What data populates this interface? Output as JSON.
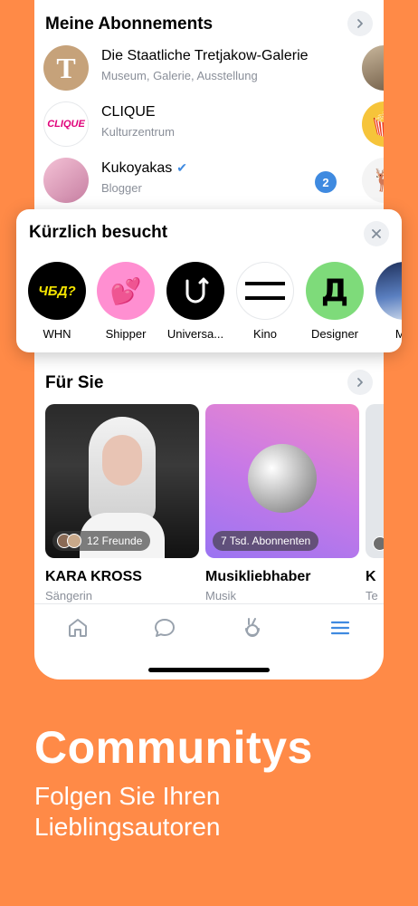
{
  "subscriptions": {
    "title": "Meine Abonnements",
    "items": [
      {
        "name": "Die Staatliche Tretjakow-Galerie",
        "desc": "Museum, Galerie, Ausstellung",
        "avatar_letter": "T",
        "avatar_color": "#C6A27A"
      },
      {
        "name": "CLIQUE",
        "desc": "Kulturzentrum",
        "avatar_text": "CLIQUE",
        "avatar_color": "#FFFFFF"
      },
      {
        "name": "Kukoyakas",
        "desc": "Blogger",
        "badge": "2",
        "avatar_color": "#E8C7D6"
      }
    ]
  },
  "recent": {
    "title": "Kürzlich besucht",
    "items": [
      {
        "label": "WHN",
        "logo_text": "ЧБД?",
        "bg": "#000000",
        "fg": "#F5E400"
      },
      {
        "label": "Shipper",
        "logo_text": "💕",
        "bg": "#FF8FD1",
        "fg": "#FFFFFF"
      },
      {
        "label": "Universa...",
        "logo_text": "U",
        "bg": "#000000",
        "fg": "#FFFFFF"
      },
      {
        "label": "Kino",
        "logo_text": "",
        "bg": "#FFFFFF",
        "fg": "#000000"
      },
      {
        "label": "Designer",
        "logo_text": "Д",
        "bg": "#7EDB7A",
        "fg": "#000000"
      },
      {
        "label": "Мы",
        "logo_text": "",
        "bg": "#3B5A93",
        "fg": "#FFFFFF"
      }
    ]
  },
  "for_you": {
    "title": "Für Sie",
    "cards": [
      {
        "title": "KARA KROSS",
        "subtitle": "Sängerin",
        "pill": "12 Freunde"
      },
      {
        "title": "Musikliebhaber",
        "subtitle": "Musik",
        "pill": "7 Tsd. Abonnenten"
      },
      {
        "title": "K",
        "subtitle": "Te",
        "pill": ""
      }
    ]
  },
  "tabs": [
    "home-icon",
    "messages-icon",
    "clips-icon",
    "menu-icon"
  ],
  "colors": {
    "accent": "#3F8AE0",
    "background": "#FF8A47"
  },
  "promo": {
    "headline": "Communitys",
    "subline": "Folgen Sie Ihren Lieblingsautoren"
  }
}
